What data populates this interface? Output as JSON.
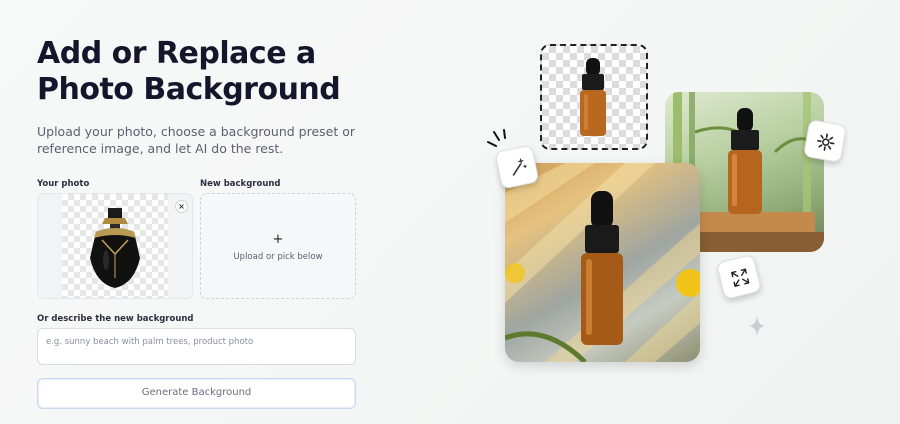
{
  "hero": {
    "title": "Add or Replace a Photo Background",
    "subtitle": "Upload your photo, choose a background preset or reference image, and let AI do the rest."
  },
  "form": {
    "your_photo_label": "Your photo",
    "new_background_label": "New background",
    "remove_photo": "×",
    "new_background_plus": "+",
    "new_background_hint": "Upload or pick below",
    "describe_label": "Or describe the new background",
    "describe_placeholder": "e.g. sunny beach with palm trees, product photo",
    "describe_value": "",
    "generate_button": "Generate Background"
  },
  "illustration": {
    "icons": [
      "magic-wand-icon",
      "gear-icon",
      "expand-arrows-icon",
      "sparkle-icon"
    ]
  }
}
